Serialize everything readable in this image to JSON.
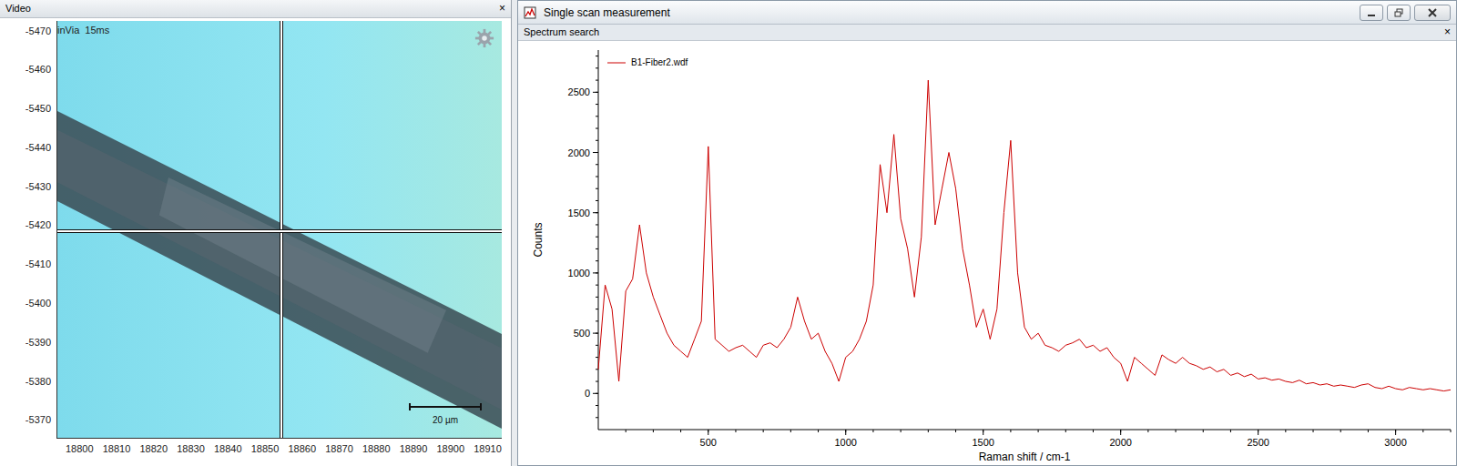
{
  "video_panel": {
    "title": "Video",
    "close": "×",
    "overlay_label": "inVia  15ms",
    "scale_bar": "20 µm",
    "y_ticks": [
      "-5470",
      "-5460",
      "-5450",
      "-5440",
      "-5430",
      "-5420",
      "-5410",
      "-5400",
      "-5390",
      "-5380",
      "-5370"
    ],
    "x_ticks": [
      "18800",
      "18810",
      "18820",
      "18830",
      "18840",
      "18850",
      "18860",
      "18870",
      "18880",
      "18890",
      "18900",
      "18910"
    ]
  },
  "window": {
    "title": "Single scan measurement"
  },
  "subpanel": {
    "title": "Spectrum search",
    "close": "×"
  },
  "chart": {
    "y_label": "Counts",
    "x_label": "Raman shift / cm-1",
    "y_ticks": [
      "0",
      "500",
      "1000",
      "1500",
      "2000",
      "2500"
    ],
    "x_ticks": [
      "500",
      "1000",
      "1500",
      "2000",
      "2500",
      "3000"
    ],
    "x_start": 100,
    "x_step": 25,
    "series": [
      {
        "name": "B1-Fiber2.wdf",
        "color": "#cc0000",
        "values": [
          200,
          900,
          700,
          100,
          850,
          950,
          1400,
          1000,
          800,
          650,
          500,
          400,
          350,
          300,
          450,
          600,
          2050,
          450,
          400,
          350,
          380,
          400,
          350,
          300,
          400,
          420,
          380,
          450,
          550,
          800,
          600,
          450,
          500,
          350,
          250,
          100,
          300,
          350,
          450,
          600,
          900,
          1900,
          1500,
          2150,
          1450,
          1200,
          800,
          1300,
          2600,
          1400,
          1700,
          2000,
          1700,
          1200,
          900,
          550,
          700,
          450,
          700,
          1500,
          2100,
          1000,
          550,
          450,
          500,
          400,
          380,
          350,
          400,
          420,
          450,
          380,
          400,
          350,
          380,
          300,
          250,
          100,
          300,
          250,
          200,
          150,
          320,
          280,
          250,
          300,
          250,
          230,
          200,
          220,
          180,
          200,
          150,
          170,
          140,
          160,
          120,
          130,
          110,
          120,
          100,
          90,
          110,
          80,
          90,
          70,
          80,
          60,
          70,
          60,
          50,
          70,
          80,
          50,
          40,
          60,
          40,
          30,
          50,
          40,
          30,
          40,
          30,
          20,
          30
        ]
      }
    ]
  }
}
